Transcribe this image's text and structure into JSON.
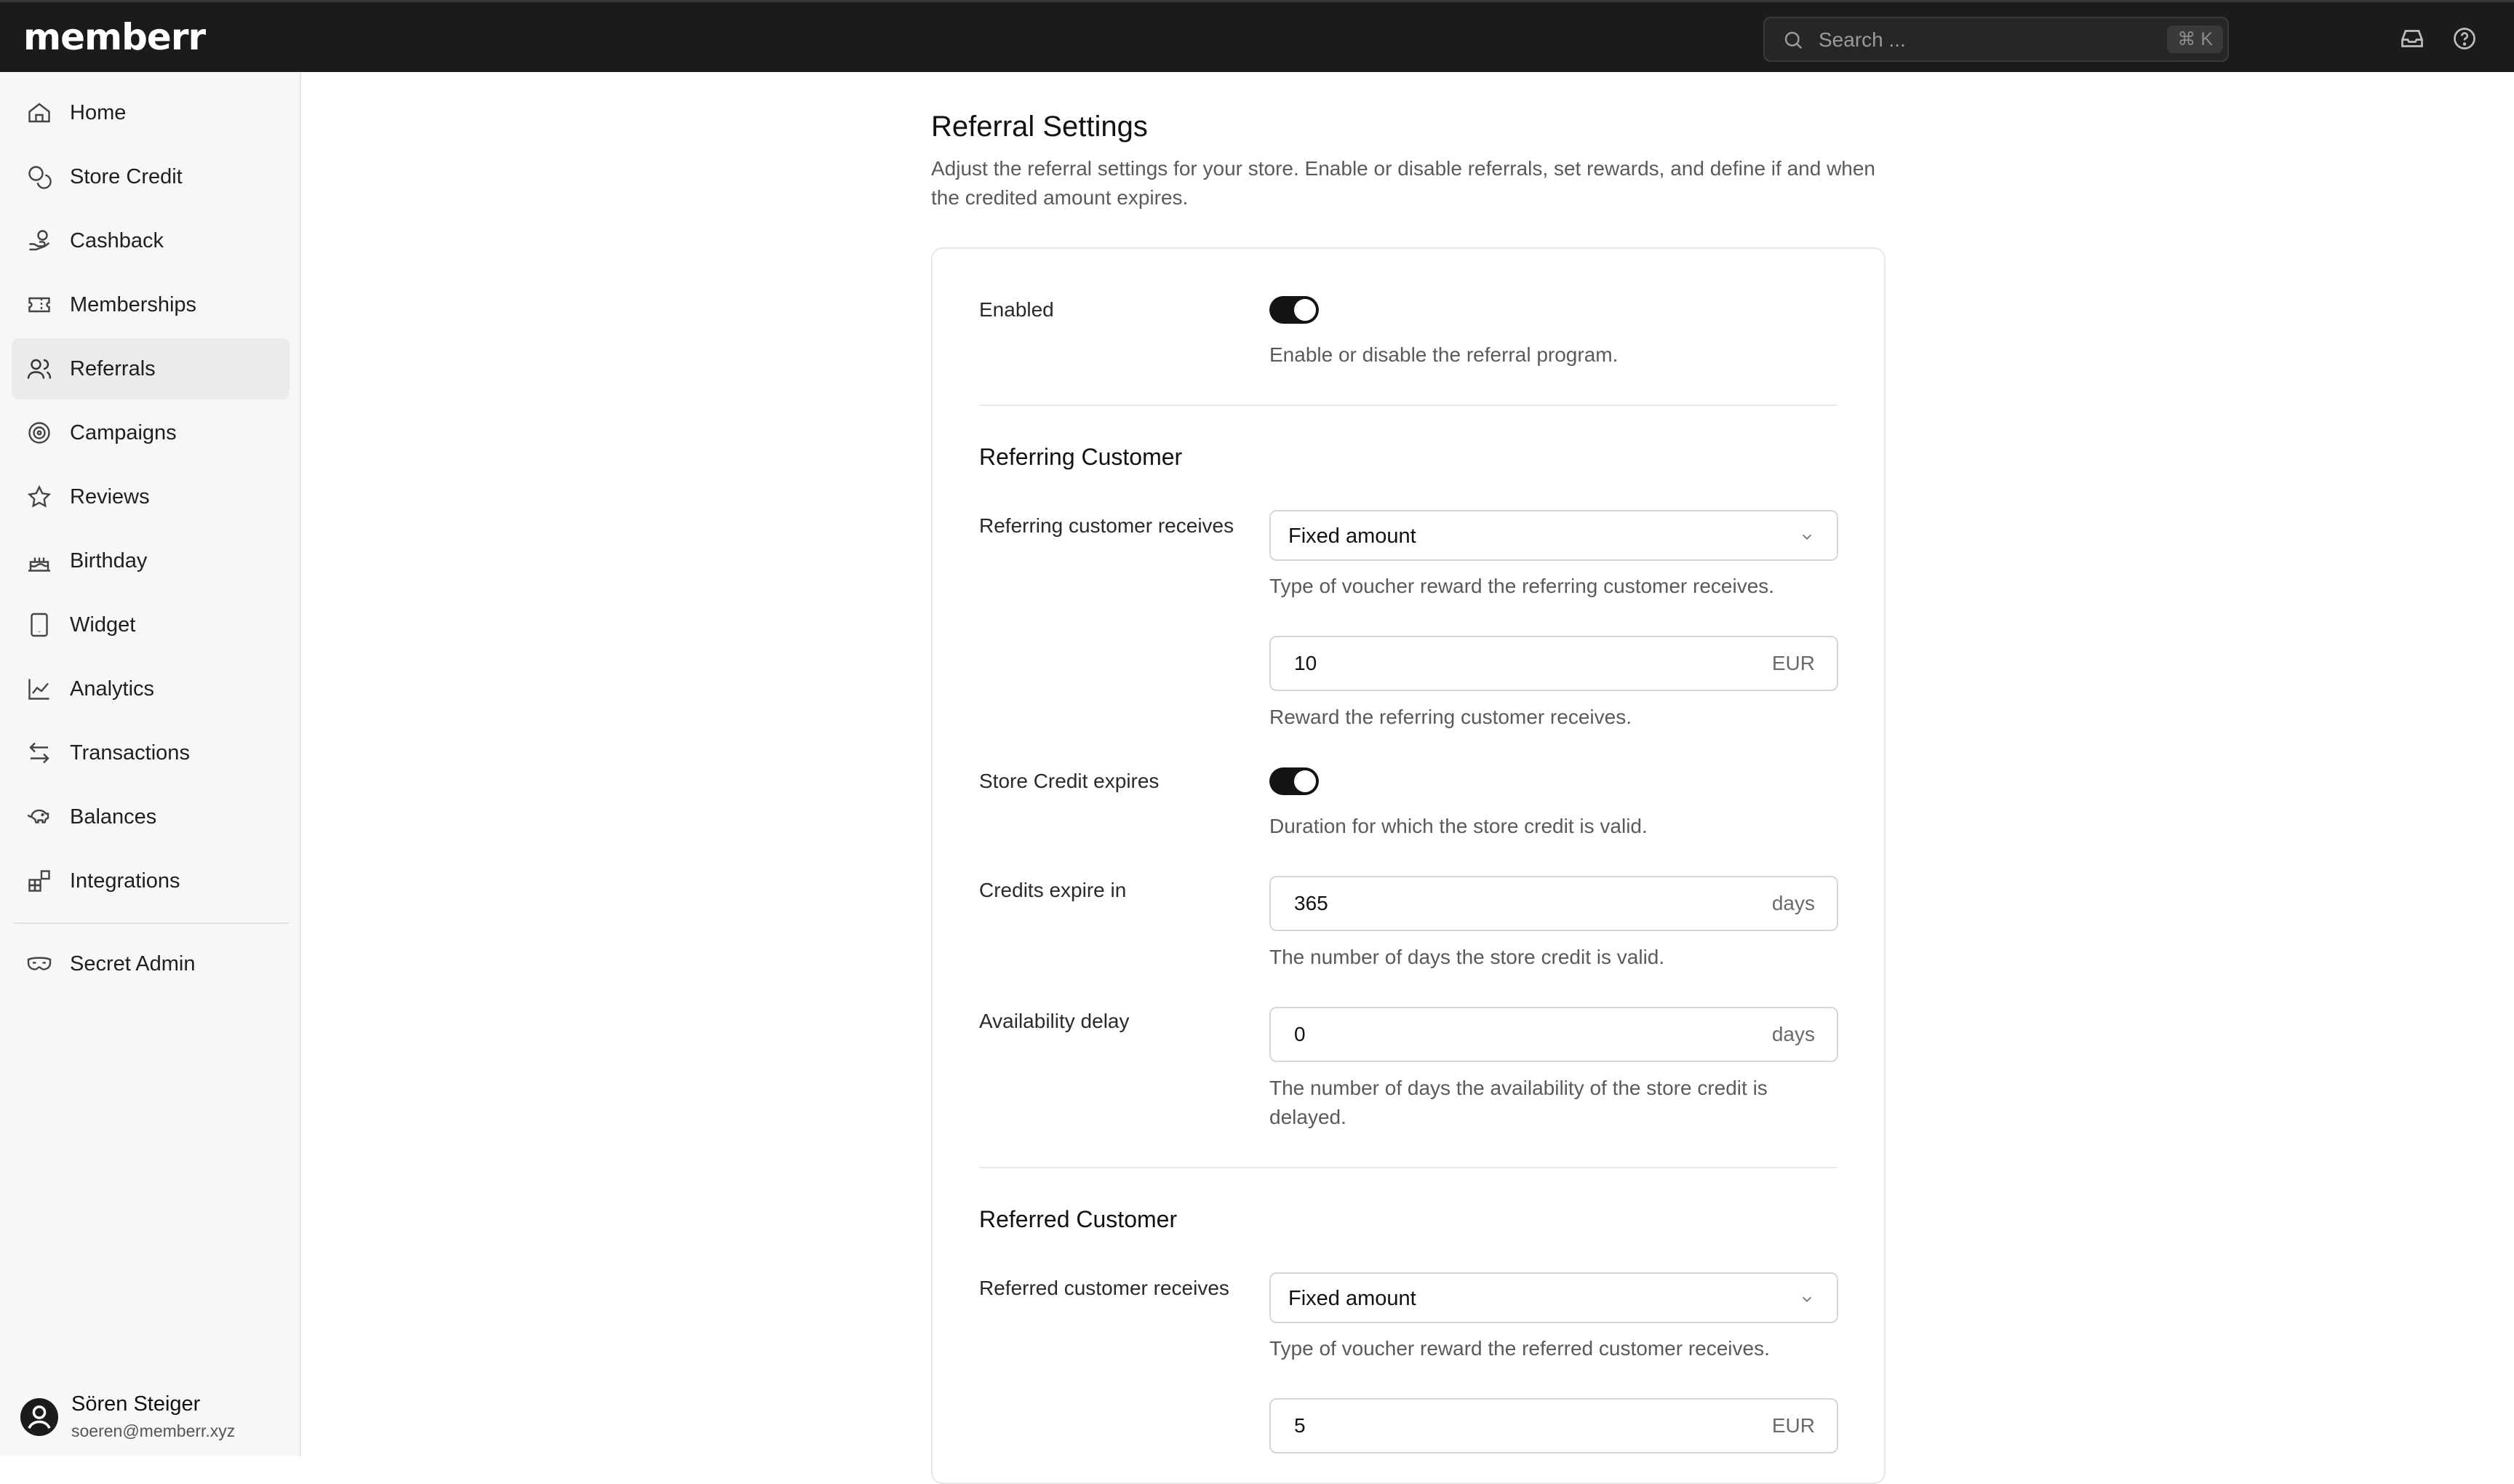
{
  "app": {
    "logo_text": "memberr"
  },
  "topbar": {
    "search_placeholder": "Search ...",
    "search_shortcut": "⌘ K",
    "icons": [
      "search-icon",
      "inbox-icon",
      "help-icon"
    ]
  },
  "sidebar": {
    "items": [
      {
        "label": "Home",
        "icon": "home-icon"
      },
      {
        "label": "Store Credit",
        "icon": "coins-icon"
      },
      {
        "label": "Cashback",
        "icon": "hand-coins-icon"
      },
      {
        "label": "Memberships",
        "icon": "ticket-icon"
      },
      {
        "label": "Referrals",
        "icon": "users-icon",
        "active": true
      },
      {
        "label": "Campaigns",
        "icon": "target-icon"
      },
      {
        "label": "Reviews",
        "icon": "star-icon"
      },
      {
        "label": "Birthday",
        "icon": "cake-icon"
      },
      {
        "label": "Widget",
        "icon": "tablet-icon"
      },
      {
        "label": "Analytics",
        "icon": "chart-icon"
      },
      {
        "label": "Transactions",
        "icon": "arrows-left-right-icon"
      },
      {
        "label": "Balances",
        "icon": "piggy-bank-icon"
      },
      {
        "label": "Integrations",
        "icon": "blocks-icon"
      }
    ],
    "admin_item": {
      "label": "Secret Admin",
      "icon": "mask-icon"
    },
    "user": {
      "name": "Sören Steiger",
      "email": "soeren@memberr.xyz"
    }
  },
  "main": {
    "title": "Referral Settings",
    "description": "Adjust the referral settings for your store. Enable or disable referrals, set rewards, and define if and when the credited amount expires.",
    "enabled": {
      "label": "Enabled",
      "on": true,
      "help": "Enable or disable the referral program."
    },
    "referring": {
      "section_title": "Referring Customer",
      "receives_label": "Referring customer receives",
      "receives_value": "Fixed amount",
      "receives_help": "Type of voucher reward the referring customer receives.",
      "amount_value": "10",
      "amount_unit": "EUR",
      "amount_help": "Reward the referring customer receives.",
      "expires_label": "Store Credit expires",
      "expires_on": true,
      "expires_help": "Duration for which the store credit is valid.",
      "expire_in_label": "Credits expire in",
      "expire_in_value": "365",
      "expire_in_unit": "days",
      "expire_in_help": "The number of days the store credit is valid.",
      "delay_label": "Availability delay",
      "delay_value": "0",
      "delay_unit": "days",
      "delay_help": "The number of days the availability of the store credit is delayed."
    },
    "referred": {
      "section_title": "Referred Customer",
      "receives_label": "Referred customer receives",
      "receives_value": "Fixed amount",
      "receives_help": "Type of voucher reward the referred customer receives.",
      "amount_value": "5",
      "amount_unit": "EUR"
    }
  }
}
